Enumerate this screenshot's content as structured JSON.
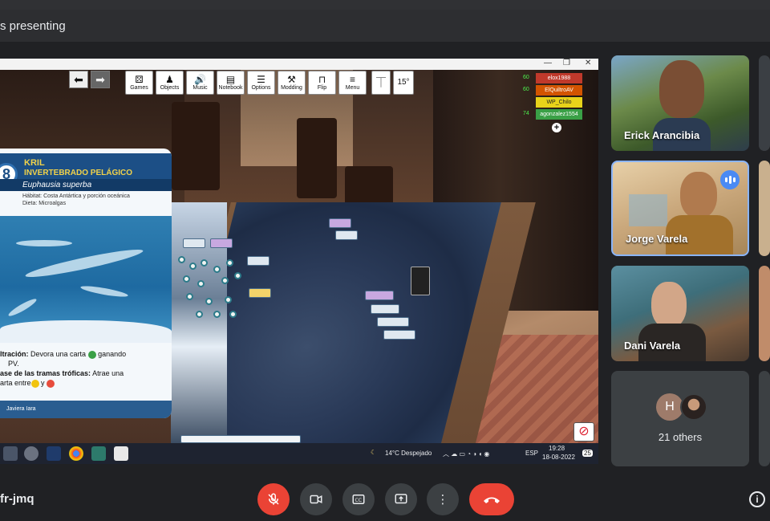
{
  "header": {
    "presenting": "s presenting"
  },
  "game_window": {
    "toolbar": [
      {
        "label": "Games",
        "icon": "dice-icon",
        "glyph": "⚄"
      },
      {
        "label": "Objects",
        "icon": "pawn-icon",
        "glyph": "♟"
      },
      {
        "label": "Music",
        "icon": "speaker-icon",
        "glyph": "🔊"
      },
      {
        "label": "Notebook",
        "icon": "notebook-icon",
        "glyph": "▤"
      },
      {
        "label": "Options",
        "icon": "sliders-icon",
        "glyph": "☰"
      },
      {
        "label": "Modding",
        "icon": "tools-icon",
        "glyph": "⚒"
      },
      {
        "label": "Flip",
        "icon": "flip-table-icon",
        "glyph": "⊓"
      },
      {
        "label": "Menu",
        "icon": "hamburger-icon",
        "glyph": "≡"
      }
    ],
    "rotation": "15°",
    "players": [
      {
        "score": "60",
        "name": "elox1988",
        "color": "#c0392b"
      },
      {
        "score": "60",
        "name": "ElQuiltroAV (nlnds)",
        "color": "#d35400"
      },
      {
        "score": "",
        "name": "WP_Chilo",
        "color": "#e8d21a"
      },
      {
        "score": "74",
        "name": "agonzalez1554",
        "color": "#3aa046"
      }
    ],
    "card": {
      "number": "8",
      "title": "KRIL",
      "subtitle": "INVERTEBRADO PELÁGICO",
      "species": "Euphausia superba",
      "habitat": "Hábitat: Costa Antártica y porción oceánica",
      "diet": "Dieta: Microalgas",
      "ability1_title": "ltración:",
      "ability1_text": " Devora una carta ",
      "ability1_suffix": " ganando",
      "ability1_line2": "PV.",
      "ability2_title": "ase de las tramas tróficas:",
      "ability2_text": " Atrae una",
      "ability2_line2": "arta entre",
      "ability2_and": " y ",
      "artist": "Javiera Iara"
    },
    "taskbar": {
      "weather": "14°C  Despejado",
      "lang": "ESP",
      "time": "19:28",
      "date": "18-08-2022",
      "notifications": "25"
    }
  },
  "participants": [
    {
      "name": "Erick Arancibia"
    },
    {
      "name": "Jorge Varela",
      "speaking": true
    },
    {
      "name": "Dani Varela"
    }
  ],
  "others": {
    "initial": "H",
    "label": "21 others"
  },
  "meeting": {
    "code": "fr-jmq"
  }
}
